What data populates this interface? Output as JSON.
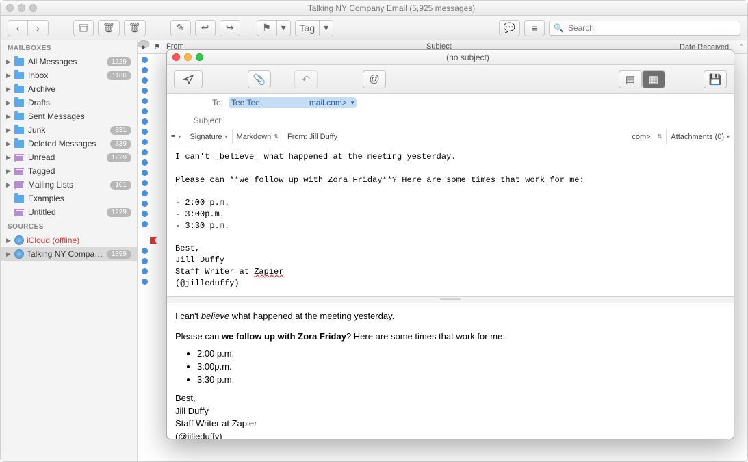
{
  "window": {
    "title": "Talking NY Company Email (5,925 messages)"
  },
  "toolbar": {
    "search_placeholder": "Search",
    "tag_label": "Tag"
  },
  "sidebar": {
    "heading_mailboxes": "MAILBOXES",
    "heading_sources": "SOURCES",
    "items": [
      {
        "label": "All Messages",
        "badge": "1229",
        "type": "folder"
      },
      {
        "label": "Inbox",
        "badge": "1186",
        "type": "folder"
      },
      {
        "label": "Archive",
        "badge": "",
        "type": "folder"
      },
      {
        "label": "Drafts",
        "badge": "",
        "type": "folder"
      },
      {
        "label": "Sent Messages",
        "badge": "",
        "type": "folder"
      },
      {
        "label": "Junk",
        "badge": "331",
        "type": "folder"
      },
      {
        "label": "Deleted Messages",
        "badge": "339",
        "type": "folder"
      },
      {
        "label": "Unread",
        "badge": "1229",
        "type": "smart"
      },
      {
        "label": "Tagged",
        "badge": "",
        "type": "smart"
      },
      {
        "label": "Mailing Lists",
        "badge": "101",
        "type": "smart"
      },
      {
        "label": "Examples",
        "badge": "",
        "type": "folder"
      },
      {
        "label": "Untitled",
        "badge": "1229",
        "type": "smart"
      }
    ],
    "sources": [
      {
        "label": "iCloud (offline)",
        "badge": "",
        "offline": true
      },
      {
        "label": "Talking NY Company…",
        "badge": "1899",
        "selected": true
      }
    ]
  },
  "columns": {
    "from": "From",
    "subject": "Subject",
    "date": "Date Received"
  },
  "compose": {
    "title": "(no subject)",
    "to_label": "To:",
    "to_name": "Tee Tee",
    "to_addr": "mail.com>",
    "subject_label": "Subject:",
    "subject_value": "",
    "signature_label": "Signature",
    "format_label": "Markdown",
    "from_label": "From: Jill Duffy",
    "from_addr": "com>",
    "attachments_label": "Attachments (0)",
    "raw_text": "I can't _believe_ what happened at the meeting yesterday.\n\nPlease can **we follow up with Zora Friday**? Here are some times that work for me:\n\n- 2:00 p.m.\n- 3:00p.m.\n- 3:30 p.m.\n\nBest,\nJill Duffy\nStaff Writer at ",
    "raw_zapier": "Zapier",
    "raw_handle": "\n(@jilleduffy)",
    "preview": {
      "line1_a": "I can't ",
      "line1_b": "believe",
      "line1_c": " what happened at the meeting yesterday.",
      "line2_a": "Please can ",
      "line2_b": "we follow up with Zora Friday",
      "line2_c": "? Here are some times that work for me:",
      "bullets": [
        "2:00 p.m.",
        "3:00p.m.",
        "3:30 p.m."
      ],
      "sig1": "Best,",
      "sig2": "Jill Duffy",
      "sig3": "Staff Writer at Zapier",
      "sig4": "(@jilleduffy)"
    }
  }
}
